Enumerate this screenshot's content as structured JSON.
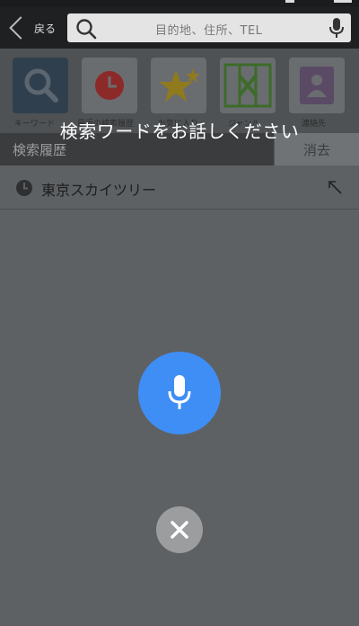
{
  "header": {
    "back_label": "戻る",
    "search_placeholder": "目的地、住所、TEL"
  },
  "categories": [
    {
      "label": "キーワード",
      "icon": "search-icon"
    },
    {
      "label": "最近の検索履歴",
      "icon": "clock-icon"
    },
    {
      "label": "お気に入り",
      "icon": "star-icon"
    },
    {
      "label": "ジャンル",
      "icon": "restaurant-icon"
    },
    {
      "label": "連絡先",
      "icon": "contact-icon"
    }
  ],
  "history": {
    "title": "検索履歴",
    "clear_label": "消去",
    "items": [
      "東京スカイツリー"
    ]
  },
  "voice": {
    "prompt": "検索ワードをお話しください"
  },
  "colors": {
    "mic_button": "#3f8ef5",
    "overlay": "#5e6163"
  }
}
